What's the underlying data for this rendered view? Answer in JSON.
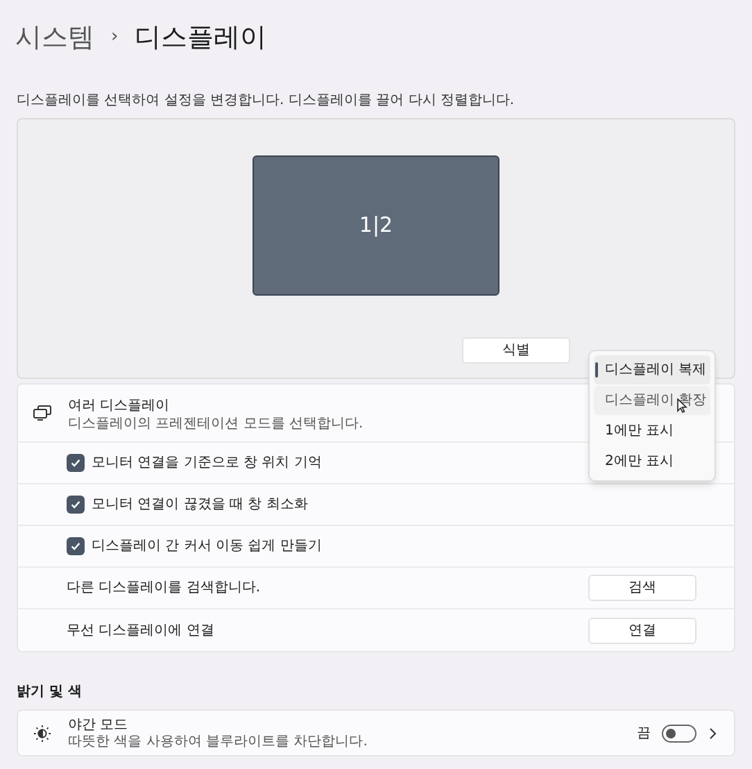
{
  "breadcrumb": {
    "parent": "시스템",
    "separator": "›",
    "current": "디스플레이"
  },
  "arrange_hint": "디스플레이를 선택하여 설정을 변경합니다. 디스플레이를 끌어 다시 정렬합니다.",
  "monitor": {
    "label": "1|2"
  },
  "identify_button": "식별",
  "mode_menu": [
    {
      "label": "디스플레이 복제",
      "selected": true,
      "hovered": false
    },
    {
      "label": "디스플레이 확장",
      "selected": false,
      "hovered": true
    },
    {
      "label": "1에만 표시",
      "selected": false,
      "hovered": false
    },
    {
      "label": "2에만 표시",
      "selected": false,
      "hovered": false
    }
  ],
  "multiple_displays": {
    "title": "여러 디스플레이",
    "subtitle": "디스플레이의 프레젠테이션 모드를 선택합니다.",
    "rows": [
      {
        "kind": "checkbox",
        "label": "모니터 연결을 기준으로 창 위치 기억",
        "checked": true
      },
      {
        "kind": "checkbox",
        "label": "모니터 연결이 끊겼을 때 창 최소화",
        "checked": true
      },
      {
        "kind": "checkbox",
        "label": "디스플레이 간 커서 이동 쉽게 만들기",
        "checked": true
      },
      {
        "kind": "button",
        "label": "다른 디스플레이를 검색합니다.",
        "button": "검색"
      },
      {
        "kind": "button",
        "label": "무선 디스플레이에 연결",
        "button": "연결"
      }
    ]
  },
  "brightness_section": {
    "heading": "밝기 및 색",
    "night_light": {
      "title": "야간 모드",
      "subtitle": "따뜻한 색을 사용하여 블루라이트를 차단합니다.",
      "state_label": "끔",
      "on": false
    }
  }
}
